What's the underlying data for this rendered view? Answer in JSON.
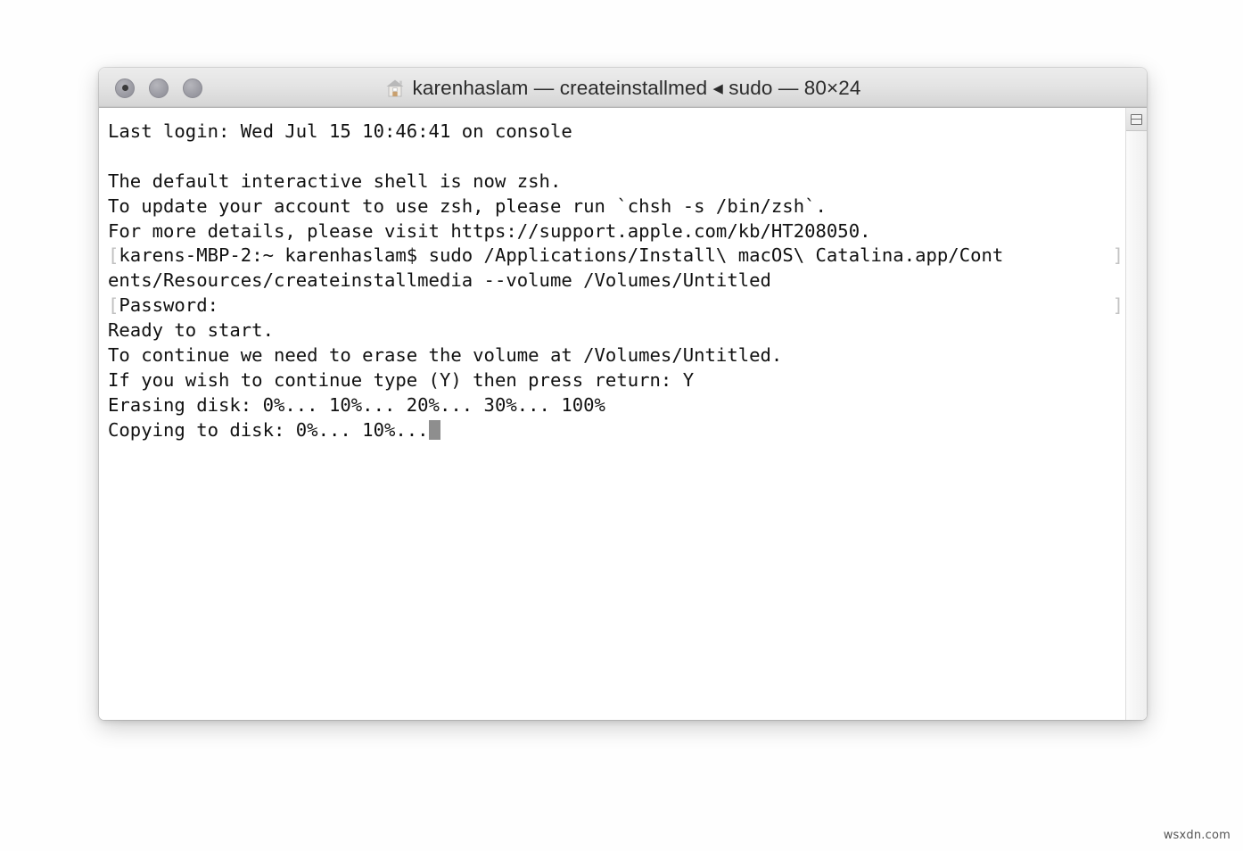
{
  "window": {
    "title": "karenhaslam — createinstallmed ◂ sudo — 80×24",
    "home_icon": "home-icon",
    "traffic_lights": [
      {
        "name": "close",
        "label": "",
        "has_dot": true
      },
      {
        "name": "minimize",
        "label": "",
        "has_dot": false
      },
      {
        "name": "zoom",
        "label": "",
        "has_dot": false
      }
    ],
    "colors": {
      "titlebar_top": "#ececec",
      "titlebar_bottom": "#c2c2c2",
      "terminal_bg": "#ffffff",
      "terminal_fg": "#111111",
      "cursor": "#8e8e8e",
      "wrap_marker": "#c0c0c0"
    }
  },
  "scrollbar": {
    "split_button_label": "split-pane"
  },
  "terminal": {
    "lines": [
      {
        "prefix": "",
        "text": "Last login: Wed Jul 15 10:46:41 on console",
        "right_marker": "",
        "cursor": false
      },
      {
        "prefix": "",
        "text": "",
        "right_marker": "",
        "cursor": false
      },
      {
        "prefix": "",
        "text": "The default interactive shell is now zsh.",
        "right_marker": "",
        "cursor": false
      },
      {
        "prefix": "",
        "text": "To update your account to use zsh, please run `chsh -s /bin/zsh`.",
        "right_marker": "",
        "cursor": false
      },
      {
        "prefix": "",
        "text": "For more details, please visit https://support.apple.com/kb/HT208050.",
        "right_marker": "",
        "cursor": false
      },
      {
        "prefix": "[",
        "text": "karens-MBP-2:~ karenhaslam$ sudo /Applications/Install\\ macOS\\ Catalina.app/Cont",
        "right_marker": "]",
        "cursor": false
      },
      {
        "prefix": "",
        "text": "ents/Resources/createinstallmedia --volume /Volumes/Untitled",
        "right_marker": "",
        "cursor": false
      },
      {
        "prefix": "[",
        "text": "Password:",
        "right_marker": "]",
        "cursor": false
      },
      {
        "prefix": "",
        "text": "Ready to start.",
        "right_marker": "",
        "cursor": false
      },
      {
        "prefix": "",
        "text": "To continue we need to erase the volume at /Volumes/Untitled.",
        "right_marker": "",
        "cursor": false
      },
      {
        "prefix": "",
        "text": "If you wish to continue type (Y) then press return: Y",
        "right_marker": "",
        "cursor": false
      },
      {
        "prefix": "",
        "text": "Erasing disk: 0%... 10%... 20%... 30%... 100%",
        "right_marker": "",
        "cursor": false
      },
      {
        "prefix": "",
        "text": "Copying to disk: 0%... 10%...",
        "right_marker": "",
        "cursor": true
      }
    ]
  },
  "watermark": {
    "text": "wsxdn.com"
  }
}
